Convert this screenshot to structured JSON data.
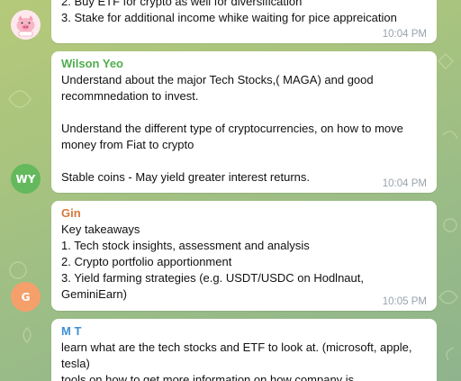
{
  "messages": [
    {
      "sender": "",
      "lines": [
        "2. Buy ETF for crypto as well for diversification",
        "3. Stake for additional income whike waiting for pice appreication"
      ],
      "time": "10:04 PM",
      "avatar": {
        "type": "image",
        "icon": "pig-sticker-avatar"
      }
    },
    {
      "sender": "Wilson Yeo",
      "sender_color": "#4fae4e",
      "lines": [
        "Understand about the major Tech Stocks,( MAGA) and good recommnedation to invest.",
        "",
        "Understand the different type of cryptocurrencies, on how to move money from Fiat to crypto",
        "",
        "Stable coins - May yield greater interest returns."
      ],
      "time": "10:04 PM",
      "avatar": {
        "initials": "WY",
        "color": "#63b95c"
      }
    },
    {
      "sender": "Gin",
      "sender_color": "#d4783c",
      "lines": [
        "Key takeaways",
        "1. Tech stock insights, assessment and analysis",
        "2. Crypto portfolio apportionment",
        "3. Yield farming strategies (e.g. USDT/USDC on Hodlnaut, GeminiEarn)"
      ],
      "time": "10:05 PM",
      "avatar": {
        "initials": "G",
        "color": "#f5a06b"
      }
    },
    {
      "sender": "M T",
      "sender_color": "#3f8fd4",
      "lines": [
        "learn what are the tech stocks and ETF to look at. (microsoft, apple, tesla)",
        "tools on how to get more information on how company is"
      ],
      "time": "",
      "avatar": null
    }
  ]
}
